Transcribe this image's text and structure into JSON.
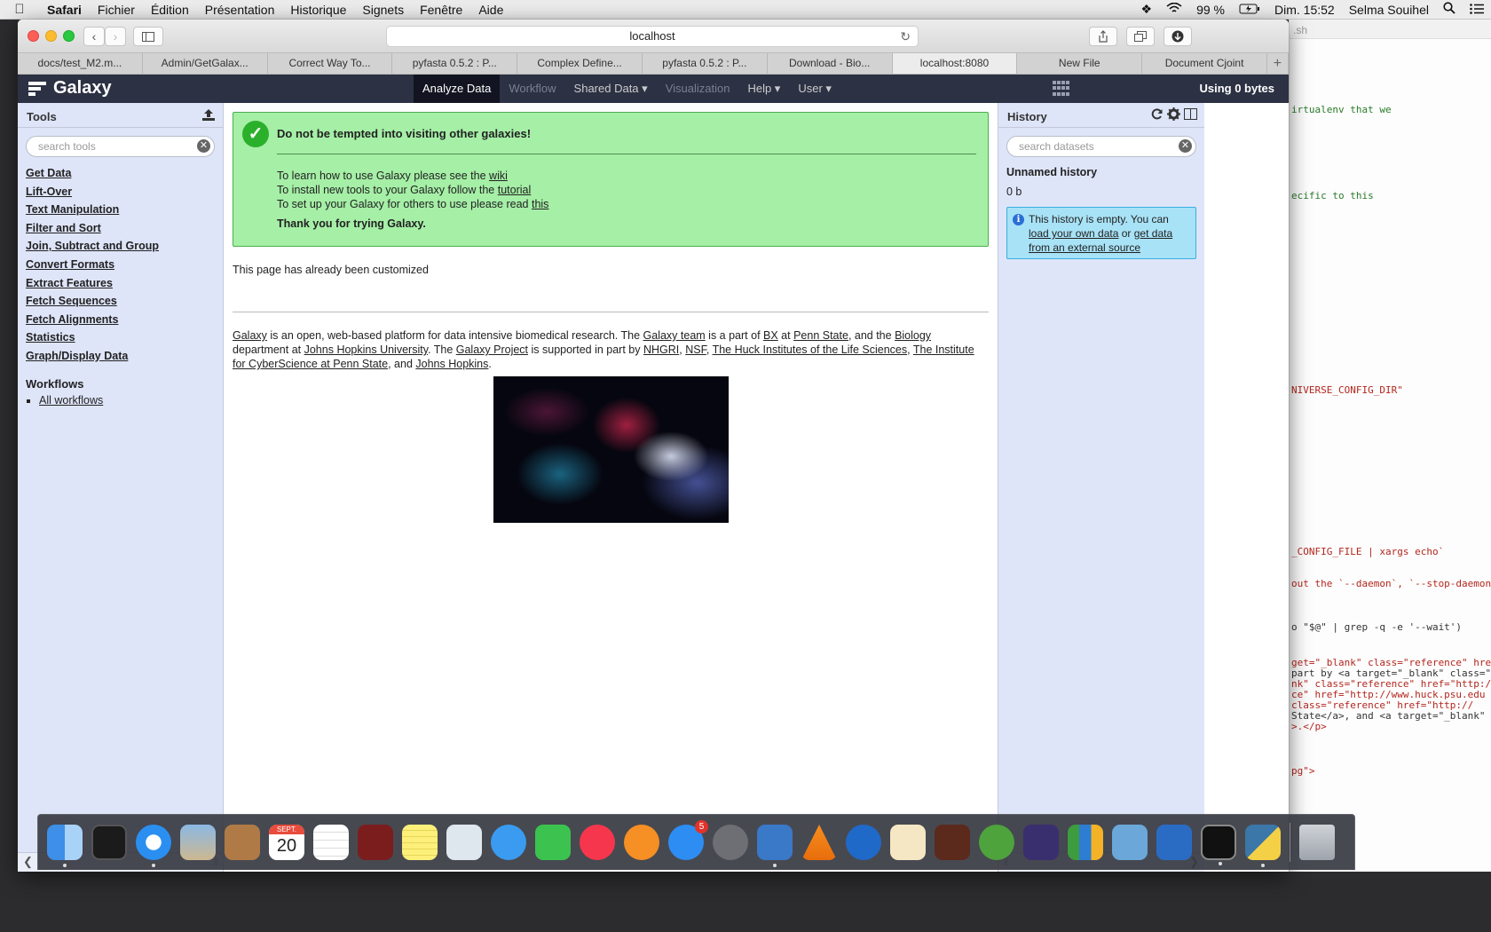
{
  "menubar": {
    "app": "Safari",
    "items": [
      "Fichier",
      "Édition",
      "Présentation",
      "Historique",
      "Signets",
      "Fenêtre",
      "Aide"
    ],
    "battery": "99 %",
    "clock": "Dim. 15:52",
    "user": "Selma Souihel"
  },
  "browser": {
    "address": "localhost",
    "tabs": [
      "docs/test_M2.m...",
      "Admin/GetGalax...",
      "Correct Way To...",
      "pyfasta 0.5.2 : P...",
      "Complex Define...",
      "pyfasta 0.5.2 : P...",
      "Download - Bio...",
      "localhost:8080",
      "New File",
      "Document Cjoint"
    ],
    "active_tab_index": 7
  },
  "masthead": {
    "brand": "Galaxy",
    "nav": [
      {
        "label": "Analyze Data",
        "state": "active"
      },
      {
        "label": "Workflow",
        "state": "disabled"
      },
      {
        "label": "Shared Data ▾",
        "state": "normal"
      },
      {
        "label": "Visualization",
        "state": "disabled"
      },
      {
        "label": "Help ▾",
        "state": "normal"
      },
      {
        "label": "User ▾",
        "state": "normal"
      }
    ],
    "quota": "Using 0 bytes"
  },
  "tools": {
    "title": "Tools",
    "search_placeholder": "search tools",
    "sections": [
      "Get Data",
      "Lift-Over",
      "Text Manipulation",
      "Filter and Sort",
      "Join, Subtract and Group",
      "Convert Formats",
      "Extract Features",
      "Fetch Sequences",
      "Fetch Alignments",
      "Statistics",
      "Graph/Display Data"
    ],
    "workflows_title": "Workflows",
    "workflows_link": "All workflows"
  },
  "welcome": {
    "heading": "Do not be tempted into visiting other galaxies!",
    "line1_prefix": "To learn how to use Galaxy please see the ",
    "line1_link": "wiki",
    "line2_prefix": "To install new tools to your Galaxy follow the ",
    "line2_link": "tutorial",
    "line3_prefix": "To set up your Galaxy for others to use please read ",
    "line3_link": "this",
    "thanks": "Thank you for trying Galaxy.",
    "customized": "This page has already been customized"
  },
  "about": {
    "l_galaxy": "Galaxy",
    "t1": " is an open, web-based platform for data intensive biomedical research. The ",
    "l_team": "Galaxy team",
    "t2": " is a part of ",
    "l_bx": "BX",
    "t3": " at ",
    "l_pennstate": "Penn State",
    "t4": ", and the ",
    "l_biology": "Biology",
    "t5": " department at ",
    "l_jhu": "Johns Hopkins University",
    "t6": ". The ",
    "l_project": "Galaxy Project",
    "t7": " is supported in part by ",
    "l_nhgri": "NHGRI",
    "t8": ", ",
    "l_nsf": "NSF",
    "t9": ", ",
    "l_huck": "The Huck Institutes of the Life Sciences",
    "t10": ", ",
    "l_ics": "The Institute for CyberScience at Penn State",
    "t11": ", and ",
    "l_jh": "Johns Hopkins",
    "t12": "."
  },
  "history": {
    "title": "History",
    "search_placeholder": "search datasets",
    "name": "Unnamed history",
    "size": "0 b",
    "empty_prefix": "This history is empty. You can ",
    "empty_link1": "load your own data",
    "empty_mid": " or ",
    "empty_link2": "get data from an external source"
  },
  "editor": {
    "tab_fragment": ".sh",
    "lines": [
      {
        "text": "irtualenv that we",
        "style": "green"
      },
      {
        "text": "ecific to this",
        "style": "green"
      },
      {
        "text": "NIVERSE_CONFIG_DIR\"",
        "style": "red"
      },
      {
        "text": "_CONFIG_FILE | xargs echo`",
        "style": "red"
      },
      {
        "text": "out the `--daemon`, `--stop-daemon`",
        "style": "red"
      },
      {
        "text": "o \"$@\" | grep -q -e '--wait')",
        "style": "dark"
      },
      {
        "text": "get=\"_blank\" class=\"reference\" hre",
        "style": "red"
      },
      {
        "text": "part by <a target=\"_blank\" class=\"",
        "style": "dark"
      },
      {
        "text": "nk\" class=\"reference\" href=\"http:/",
        "style": "red"
      },
      {
        "text": "ce\" href=\"http://www.huck.psu.edu",
        "style": "red"
      },
      {
        "text": " class=\"reference\" href=\"http://",
        "style": "red"
      },
      {
        "text": " State</a>, and <a target=\"_blank\"",
        "style": "dark"
      },
      {
        "text": ">.</p>",
        "style": "red"
      },
      {
        "text": "pg\">",
        "style": "red"
      }
    ]
  },
  "dock": {
    "calendar_month": "SEPT.",
    "calendar_day": "20",
    "appstore_badge": "5"
  }
}
